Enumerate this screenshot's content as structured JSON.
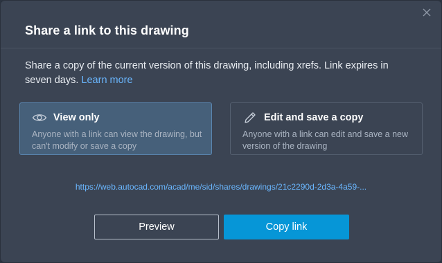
{
  "dialog": {
    "title": "Share a link to this drawing",
    "description": "Share a copy of the current version of this drawing, including xrefs. Link expires in seven days.",
    "learn_more": "Learn more",
    "close_icon": "close-icon"
  },
  "options": {
    "view": {
      "icon": "eye-icon",
      "title": "View only",
      "description": "Anyone with a link can view the drawing, but can't modify or save a copy",
      "selected": true
    },
    "edit": {
      "icon": "pencil-icon",
      "title": "Edit and save a copy",
      "description": "Anyone with a link can edit and save a new version of the drawing",
      "selected": false
    }
  },
  "share_url": "https://web.autocad.com/acad/me/sid/shares/drawings/21c2290d-2d3a-4a59-...",
  "buttons": {
    "preview": "Preview",
    "copy": "Copy link"
  },
  "colors": {
    "background": "#3b4453",
    "accent": "#0696d7",
    "link": "#6ab7ff",
    "selected_option": "#46607a"
  }
}
